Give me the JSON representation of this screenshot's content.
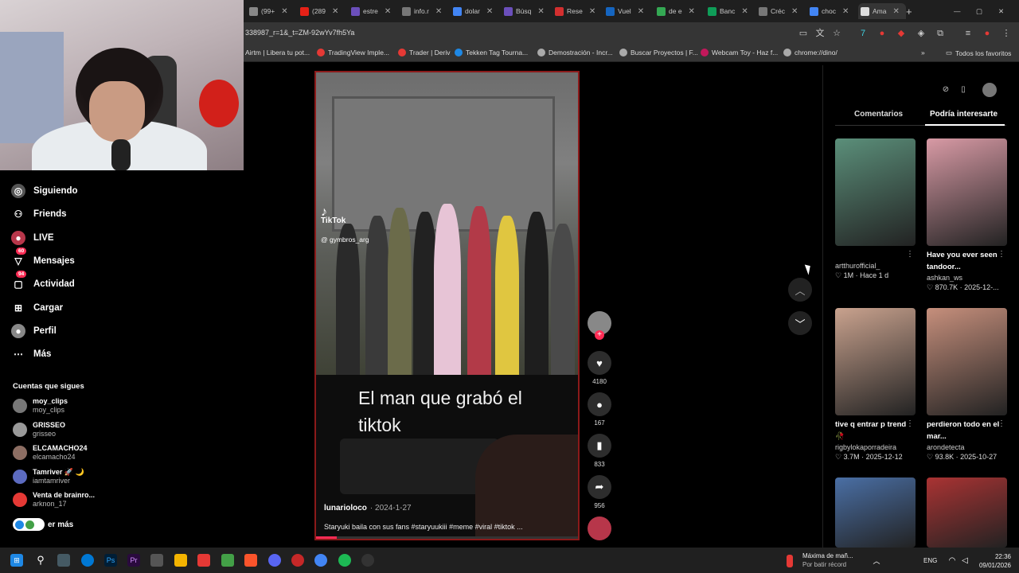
{
  "browser": {
    "tabs": [
      {
        "label": "(99+",
        "color": "#888"
      },
      {
        "label": "(289",
        "color": "#e62117"
      },
      {
        "label": "estre",
        "color": "#6b4fbb"
      },
      {
        "label": "info.r",
        "color": "#777"
      },
      {
        "label": "dolar",
        "color": "#4285f4"
      },
      {
        "label": "Búsq",
        "color": "#6b4fbb"
      },
      {
        "label": "Rese",
        "color": "#d32f2f"
      },
      {
        "label": "Vuel",
        "color": "#1565c0"
      },
      {
        "label": "de e",
        "color": "#34a853"
      },
      {
        "label": "Banc",
        "color": "#0f9d58"
      },
      {
        "label": "Créc",
        "color": "#777"
      },
      {
        "label": "choc",
        "color": "#4285f4"
      },
      {
        "label": "Ama",
        "color": "#ddd"
      }
    ],
    "new_tab": "+",
    "url": "338987_r=1&_t=ZM-92wYv7fh5Ya",
    "bookmarks": [
      {
        "label": "Airtm | Libera tu pot...",
        "color": "#00c2a8"
      },
      {
        "label": "TradingView Imple...",
        "color": "#e53935"
      },
      {
        "label": "Trader | Deriv",
        "color": "#e53935"
      },
      {
        "label": "Tekken Tag Tourna...",
        "color": "#1e88e5"
      },
      {
        "label": "Demostración - Incr...",
        "color": "#aaa"
      },
      {
        "label": "Buscar Proyectos | F...",
        "color": "#aaa"
      },
      {
        "label": "Webcam Toy - Haz f...",
        "color": "#c2185b"
      },
      {
        "label": "chrome://dino/",
        "color": "#aaa"
      }
    ],
    "all_bookmarks": "Todos los favoritos"
  },
  "sidebar": {
    "items": [
      {
        "label": "Siguiendo",
        "icon": "following-icon",
        "badge": ""
      },
      {
        "label": "Friends",
        "icon": "friends-icon",
        "badge": ""
      },
      {
        "label": "LIVE",
        "icon": "live-icon",
        "badge": ""
      },
      {
        "label": "Mensajes",
        "icon": "messages-icon",
        "badge": "60"
      },
      {
        "label": "Actividad",
        "icon": "activity-icon",
        "badge": "94"
      },
      {
        "label": "Cargar",
        "icon": "upload-icon",
        "badge": ""
      },
      {
        "label": "Perfil",
        "icon": "profile-icon",
        "badge": ""
      },
      {
        "label": "Más",
        "icon": "more-icon",
        "badge": ""
      }
    ],
    "following_title": "Cuentas que sigues",
    "accounts": [
      {
        "name": "moy_clips",
        "handle": "moy_clips",
        "color": "#777"
      },
      {
        "name": "GRISSEO",
        "handle": "grisseo",
        "color": "#999"
      },
      {
        "name": "ELCAMACHO24",
        "handle": "elcamacho24",
        "color": "#8d6e63"
      },
      {
        "name": "Tamriver 🚀 🌙",
        "handle": "iamtamriver",
        "color": "#5c6bc0"
      },
      {
        "name": "Venta de brainro...",
        "handle": "arknon_17",
        "color": "#e53935"
      }
    ],
    "see_more": "er más"
  },
  "video": {
    "watermark": "TikTok",
    "watermark_user": "@ gymbros_arg",
    "overlay_text": "El man que grabó el tiktok",
    "author": "lunarioloco",
    "date": "· 2024-1-27",
    "description": "Staryuki baila con sus fans #staryuukiii #meme #viral #tiktok ...",
    "progress": 0.08
  },
  "actions": {
    "likes": "4180",
    "comments": "167",
    "saves": "833",
    "shares": "956"
  },
  "right_panel": {
    "tabs": [
      "Comentarios",
      "Podría interesarte"
    ],
    "cards": [
      {
        "title": "",
        "author": "artthurofficial_",
        "likes": "1M",
        "date": "Hace 1 d",
        "color": "#5b8f7a"
      },
      {
        "title": "Have you ever seen tandoor...",
        "author": "ashkan_ws",
        "likes": "870.7K",
        "date": "2025-12-...",
        "color": "#d89aa5"
      },
      {
        "title": "tive q entrar p trend 🥀",
        "author": "rigbylokaporradeira",
        "likes": "3.7M",
        "date": "2025-12-12",
        "color": "#c9a28e"
      },
      {
        "title": "perdieron todo en el mar...",
        "author": "arondetecta",
        "likes": "93.8K",
        "date": "2025-10-27",
        "color": "#c68f7c"
      },
      {
        "title": "",
        "author": "",
        "likes": "",
        "date": "",
        "color": "#4a6fa5"
      },
      {
        "title": "",
        "author": "",
        "likes": "",
        "date": "",
        "color": "#a33"
      }
    ]
  },
  "taskbar": {
    "weather_title": "Máxima de mañ...",
    "weather_sub": "Por batir récord",
    "lang": "ENG",
    "time": "22:36",
    "date": "09/01/2026"
  }
}
